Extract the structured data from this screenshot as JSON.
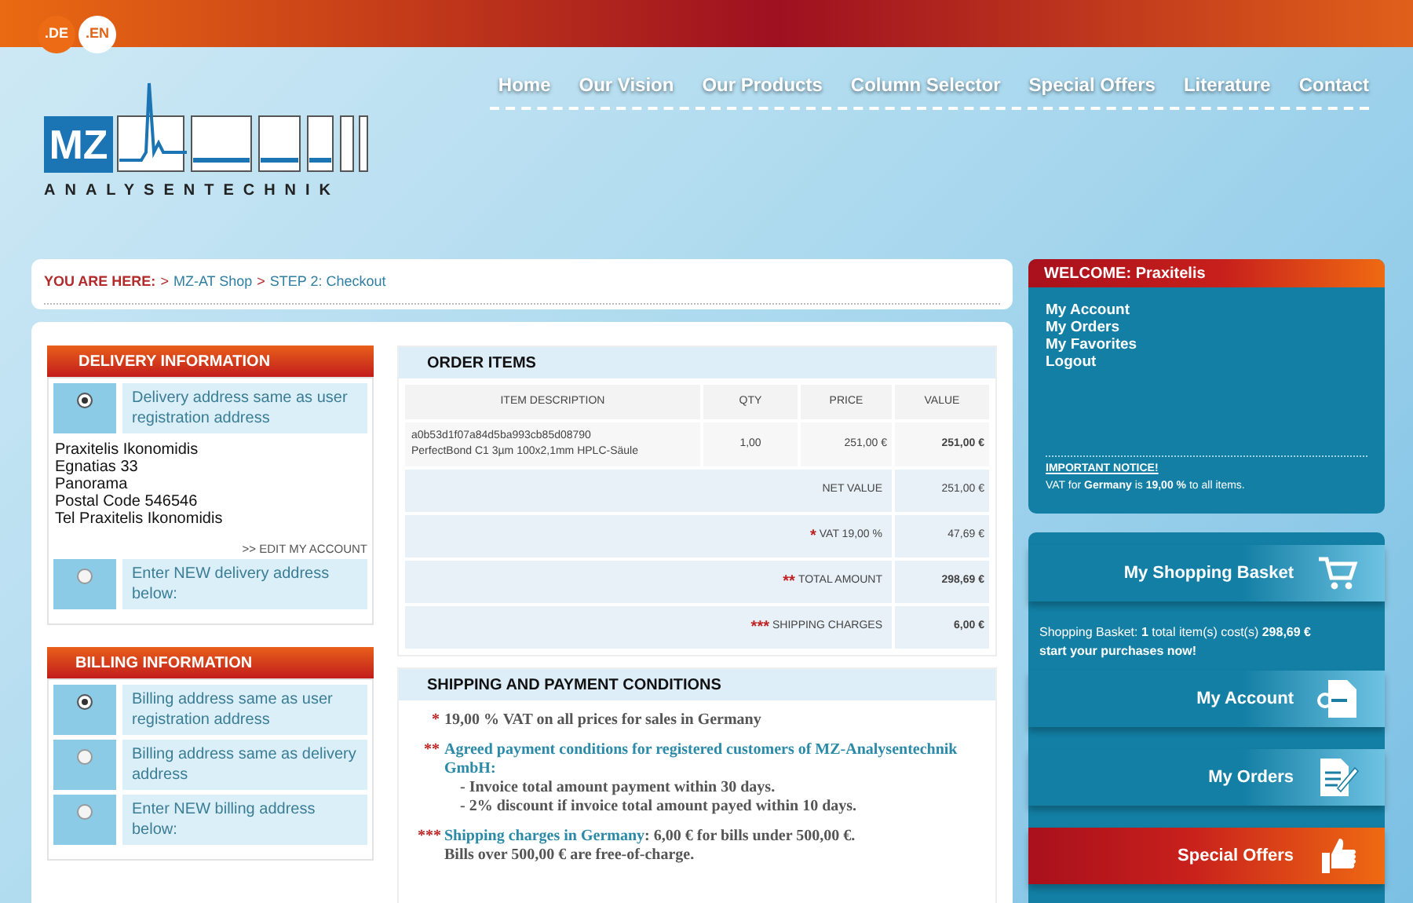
{
  "languages": [
    {
      "label": ".DE",
      "selected": false
    },
    {
      "label": ".EN",
      "selected": true
    }
  ],
  "logo": {
    "letters": "MZ",
    "wordmark": "ANALYSENTECHNIK"
  },
  "nav": [
    "Home",
    "Our Vision",
    "Our Products",
    "Column Selector",
    "Special Offers",
    "Literature",
    "Contact"
  ],
  "breadcrumb": {
    "label": "YOU ARE HERE:",
    "crumbs": [
      {
        "separator": ">",
        "text": "MZ-AT Shop"
      },
      {
        "separator": ">",
        "text": "STEP 2: Checkout"
      }
    ]
  },
  "delivery": {
    "title": "DELIVERY INFORMATION",
    "options": [
      {
        "label": "Delivery address same as user registration address",
        "selected": true
      },
      {
        "label": "Enter NEW delivery address below:",
        "selected": false
      }
    ],
    "address": [
      "Praxitelis Ikonomidis",
      "Egnatias 33",
      "Panorama",
      "Postal Code 546546",
      "Tel Praxitelis Ikonomidis"
    ],
    "edit_link": ">> EDIT MY ACCOUNT"
  },
  "billing": {
    "title": "BILLING INFORMATION",
    "options": [
      {
        "label": "Billing address same as user registration address",
        "selected": true
      },
      {
        "label": "Billing address same as delivery address",
        "selected": false
      },
      {
        "label": "Enter NEW billing address below:",
        "selected": false
      }
    ]
  },
  "order": {
    "title": "ORDER ITEMS",
    "columns": [
      "ITEM DESCRIPTION",
      "QTY",
      "PRICE",
      "VALUE"
    ],
    "items": [
      {
        "code": "a0b53d1f07a84d5ba993cb85d08790",
        "name": "PerfectBond C1 3µm 100x2,1mm HPLC-Säule",
        "qty": "1,00",
        "price": "251,00 €",
        "value": "251,00 €"
      }
    ],
    "totals": [
      {
        "label": "NET VALUE",
        "value": "251,00 €",
        "bold": false
      },
      {
        "marker": "*",
        "label": "VAT 19,00 %",
        "value": "47,69 €",
        "bold": false
      },
      {
        "marker": "**",
        "label": "TOTAL AMOUNT",
        "value": "298,69 €",
        "bold": true
      },
      {
        "marker": "***",
        "label": "SHIPPING CHARGES",
        "value": "6,00 €",
        "bold": true
      }
    ]
  },
  "conditions": {
    "title": "SHIPPING AND PAYMENT CONDITIONS",
    "notes": [
      {
        "marker": "*",
        "text": "19,00 % VAT on all prices for sales in Germany"
      },
      {
        "marker": "**",
        "highlight": "Agreed payment conditions for registered customers of MZ-Analysentechnik GmbH:",
        "lines": [
          "- Invoice total amount payment within 30 days.",
          "- 2% discount if invoice total amount payed within 10 days."
        ]
      },
      {
        "marker": "***",
        "highlight": "Shipping charges in Germany",
        "text": ": 6,00 € for bills under 500,00 €.",
        "lines": [
          "Bills over 500,00 € are free-of-charge."
        ]
      }
    ]
  },
  "welcome": {
    "title": "WELCOME: Praxitelis",
    "links": [
      "My Account",
      "My Orders",
      "My Favorites",
      "Logout"
    ],
    "notice_title": "IMPORTANT NOTICE!",
    "notice": "VAT for **Germany** is **19,00 %** to all items."
  },
  "basket": {
    "title": "My Shopping Basket",
    "text": "Shopping Basket: **1** total item(s) cost(s) **298,69 €**",
    "cta": "start your purchases now!"
  },
  "tiles": [
    {
      "label": "My Account",
      "kind": "account"
    },
    {
      "label": "My Orders",
      "kind": "orders"
    },
    {
      "label": "Special Offers",
      "kind": "offers"
    }
  ]
}
